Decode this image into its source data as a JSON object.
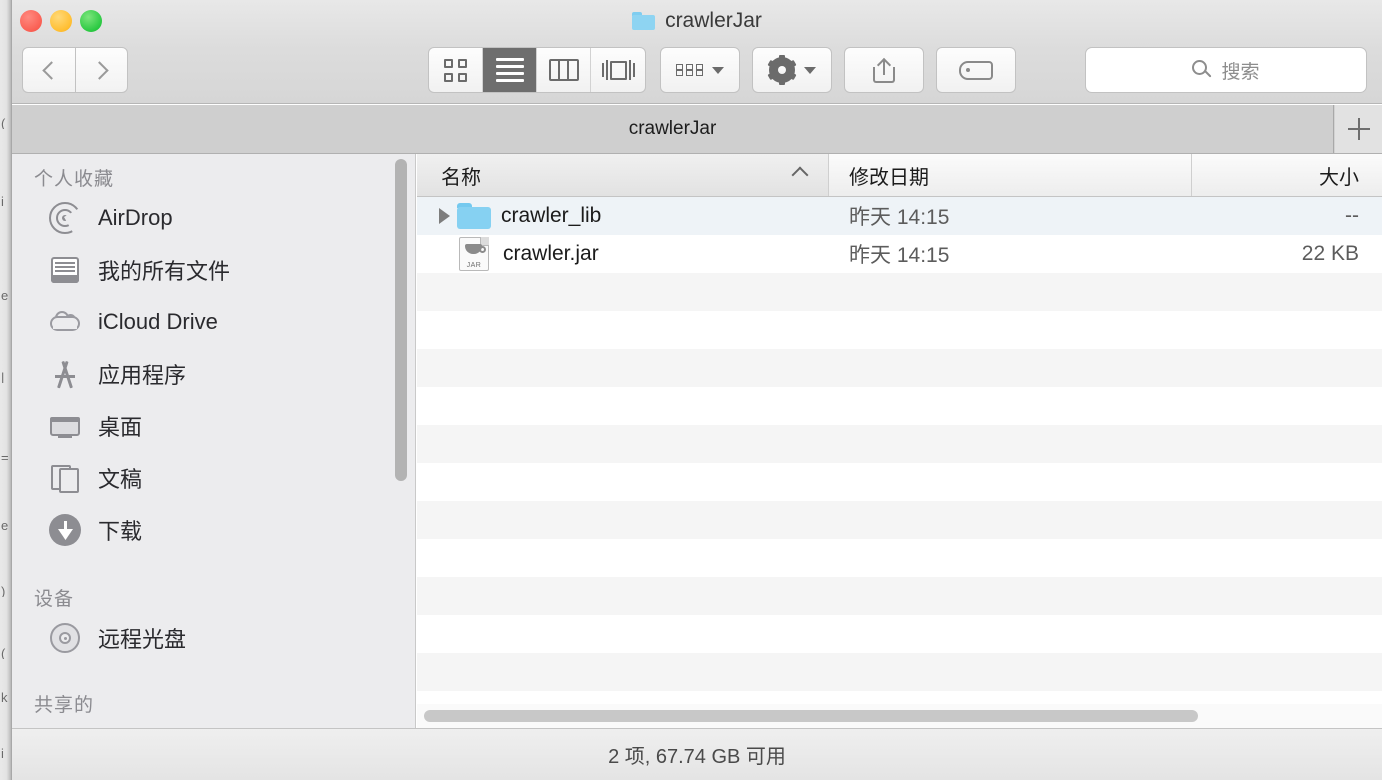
{
  "window": {
    "title": "crawlerJar",
    "traffic_lights": [
      "close",
      "minimize",
      "zoom"
    ],
    "colors": {
      "close": "#fa5e52",
      "minimize": "#ffbd2e",
      "zoom": "#28c840",
      "folder_blue": "#86d1f2"
    }
  },
  "toolbar": {
    "back_icon": "chevron-left-icon",
    "forward_icon": "chevron-right-icon",
    "view_modes": [
      {
        "name": "icon-view",
        "selected": false
      },
      {
        "name": "list-view",
        "selected": true
      },
      {
        "name": "column-view",
        "selected": false
      },
      {
        "name": "coverflow-view",
        "selected": false
      }
    ],
    "arrange_icon": "arrange-grid-icon",
    "action_icon": "gear-icon",
    "share_icon": "share-icon",
    "tag_icon": "tag-icon",
    "search": {
      "placeholder": "搜索",
      "value": "",
      "icon": "search-icon"
    }
  },
  "tabbar": {
    "tabs": [
      {
        "label": "crawlerJar",
        "active": true
      }
    ],
    "new_tab_label": "+"
  },
  "sidebar": {
    "sections": [
      {
        "header": "个人收藏",
        "items": [
          {
            "label": "AirDrop",
            "icon": "airdrop-icon"
          },
          {
            "label": "我的所有文件",
            "icon": "all-my-files-icon"
          },
          {
            "label": "iCloud Drive",
            "icon": "icloud-icon"
          },
          {
            "label": "应用程序",
            "icon": "applications-icon"
          },
          {
            "label": "桌面",
            "icon": "desktop-icon"
          },
          {
            "label": "文稿",
            "icon": "documents-icon"
          },
          {
            "label": "下载",
            "icon": "downloads-icon"
          }
        ]
      },
      {
        "header": "设备",
        "items": [
          {
            "label": "远程光盘",
            "icon": "remote-disc-icon"
          }
        ]
      },
      {
        "header": "共享的",
        "items": []
      }
    ]
  },
  "filelist": {
    "columns": [
      {
        "label": "名称",
        "sorted": true,
        "sort_direction": "asc"
      },
      {
        "label": "修改日期",
        "sorted": false
      },
      {
        "label": "大小",
        "sorted": false
      }
    ],
    "rows": [
      {
        "name": "crawler_lib",
        "date": "昨天 14:15",
        "size": "--",
        "icon": "folder-icon",
        "expandable": true,
        "selected": true
      },
      {
        "name": "crawler.jar",
        "date": "昨天 14:15",
        "size": "22 KB",
        "icon": "jar-file-icon",
        "expandable": false,
        "selected": false
      }
    ]
  },
  "statusbar": {
    "text": "2 项, 67.74 GB 可用"
  }
}
